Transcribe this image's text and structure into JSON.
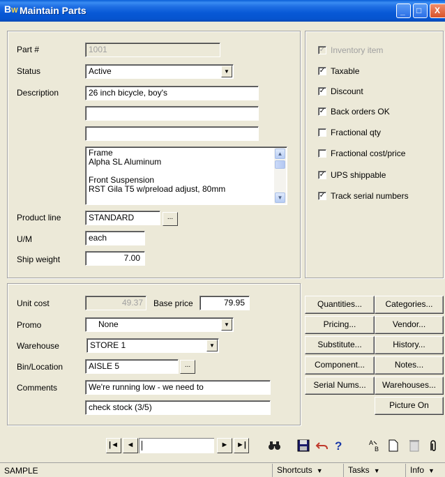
{
  "window": {
    "title": "Maintain Parts",
    "logo_b": "B",
    "logo_w": "W",
    "min_glyph": "_",
    "max_glyph": "□",
    "close_glyph": "X"
  },
  "part": {
    "part_no_label": "Part #",
    "part_no_value": "1001",
    "status_label": "Status",
    "status_value": "Active",
    "description_label": "Description",
    "description_lines": [
      "26 inch bicycle, boy's",
      "",
      ""
    ],
    "memo_lines": [
      "Frame",
      "Alpha SL Aluminum",
      "",
      "Front Suspension",
      "RST Gila T5 w/preload adjust, 80mm"
    ],
    "product_line_label": "Product line",
    "product_line_value": "STANDARD",
    "um_label": "U/M",
    "um_value": "each",
    "ship_weight_label": "Ship weight",
    "ship_weight_value": "7.00"
  },
  "flags": [
    {
      "label": "Inventory item",
      "checked": true,
      "disabled": true
    },
    {
      "label": "Taxable",
      "checked": true,
      "disabled": false
    },
    {
      "label": "Discount",
      "checked": true,
      "disabled": false
    },
    {
      "label": "Back orders OK",
      "checked": true,
      "disabled": false
    },
    {
      "label": "Fractional qty",
      "checked": false,
      "disabled": false
    },
    {
      "label": "Fractional cost/price",
      "checked": false,
      "disabled": false
    },
    {
      "label": "UPS shippable",
      "checked": true,
      "disabled": false
    },
    {
      "label": "Track serial numbers",
      "checked": true,
      "disabled": false
    }
  ],
  "pricing": {
    "unit_cost_label": "Unit cost",
    "unit_cost_value": "49.37",
    "base_price_label": "Base price",
    "base_price_value": "79.95",
    "promo_label": "Promo",
    "promo_value": "None",
    "warehouse_label": "Warehouse",
    "warehouse_value": "STORE 1",
    "bin_label": "Bin/Location",
    "bin_value": "AISLE 5",
    "comments_label": "Comments",
    "comments_line1": "We're running low - we need to",
    "comments_line2": "check stock (3/5)"
  },
  "buttons": {
    "quantities": "Quantities...",
    "categories": "Categories...",
    "pricing": "Pricing...",
    "vendor": "Vendor...",
    "substitute": "Substitute...",
    "history": "History...",
    "component": "Component...",
    "notes": "Notes...",
    "serial_nums": "Serial Nums...",
    "warehouses": "Warehouses...",
    "picture_on": "Picture On",
    "ellipsis": "..."
  },
  "nav": {
    "first": "|◄",
    "prev": "◄",
    "next": "►",
    "last": "►|"
  },
  "status": {
    "company": "SAMPLE",
    "shortcuts": "Shortcuts",
    "tasks": "Tasks",
    "info": "Info"
  }
}
